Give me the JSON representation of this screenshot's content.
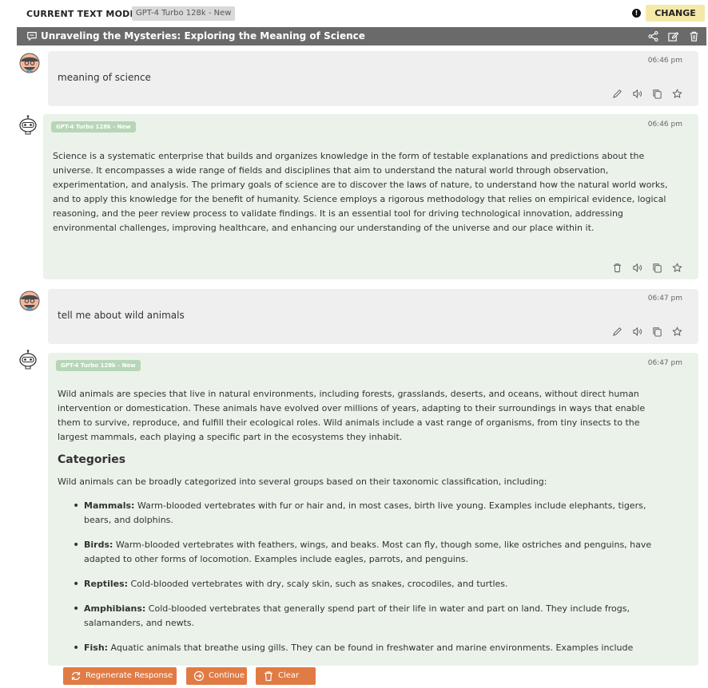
{
  "header": {
    "label": "CURRENT TEXT MODEL",
    "model": "GPT-4 Turbo 128k - New",
    "change": "CHANGE"
  },
  "conversation": {
    "title": "Unraveling the Mysteries: Exploring the Meaning of Science"
  },
  "messages": [
    {
      "role": "user",
      "time": "06:46 pm",
      "text": "meaning of science"
    },
    {
      "role": "assistant",
      "model": "GPT-4 Turbo 128k - New",
      "time": "06:46 pm",
      "text": "Science is a systematic enterprise that builds and organizes knowledge in the form of testable explanations and predictions about the universe. It encompasses a wide range of fields and disciplines that aim to understand the natural world through observation, experimentation, and analysis. The primary goals of science are to discover the laws of nature, to understand how the natural world works, and to apply this knowledge for the benefit of humanity. Science employs a rigorous methodology that relies on empirical evidence, logical reasoning, and the peer review process to validate findings. It is an essential tool for driving technological innovation, addressing environmental challenges, improving healthcare, and enhancing our understanding of the universe and our place within it."
    },
    {
      "role": "user",
      "time": "06:47 pm",
      "text": "tell me about wild animals"
    },
    {
      "role": "assistant",
      "model": "GPT-4 Turbo 128k - New",
      "time": "06:47 pm",
      "intro": "Wild animals are species that live in natural environments, including forests, grasslands, deserts, and oceans, without direct human intervention or domestication. These animals have evolved over millions of years, adapting to their surroundings in ways that enable them to survive, reproduce, and fulfill their ecological roles. Wild animals include a vast range of organisms, from tiny insects to the largest mammals, each playing a specific part in the ecosystems they inhabit.",
      "heading": "Categories",
      "lead": "Wild animals can be broadly categorized into several groups based on their taxonomic classification, including:",
      "items": [
        {
          "term": "Mammals:",
          "desc": " Warm-blooded vertebrates with fur or hair and, in most cases, birth live young. Examples include elephants, tigers, bears, and dolphins."
        },
        {
          "term": "Birds:",
          "desc": " Warm-blooded vertebrates with feathers, wings, and beaks. Most can fly, though some, like ostriches and penguins, have adapted to other forms of locomotion. Examples include eagles, parrots, and penguins."
        },
        {
          "term": "Reptiles:",
          "desc": " Cold-blooded vertebrates with dry, scaly skin, such as snakes, crocodiles, and turtles."
        },
        {
          "term": "Amphibians:",
          "desc": " Cold-blooded vertebrates that generally spend part of their life in water and part on land. They include frogs, salamanders, and newts."
        },
        {
          "term": "Fish:",
          "desc": " Aquatic animals that breathe using gills. They can be found in freshwater and marine environments. Examples include"
        }
      ]
    }
  ],
  "footer": {
    "regenerate": "Regenerate Response",
    "continue": "Continue",
    "clear": "Clear"
  },
  "colors": {
    "accent": "#e07b45",
    "change_button": "#f5e9a8",
    "title_bar": "#6a6a6a",
    "user_bubble": "#efefef",
    "bot_bubble": "#ebf2ea",
    "model_badge": "#b7d6b7"
  }
}
